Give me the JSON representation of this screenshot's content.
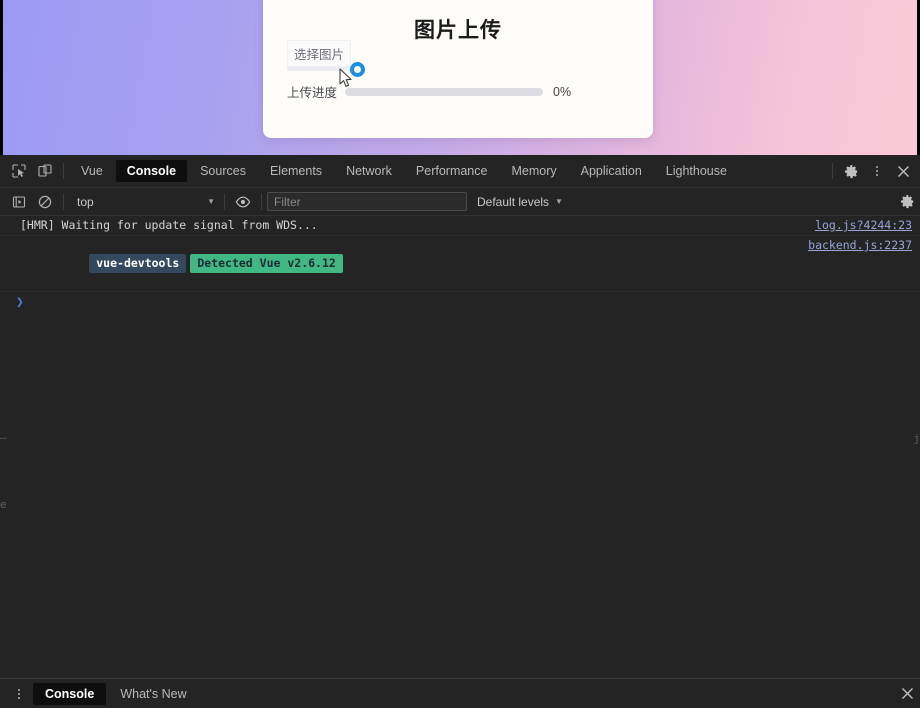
{
  "page": {
    "title": "图片上传",
    "file_button_label": "选择图片",
    "progress_label": "上传进度",
    "progress_value_text": "0%",
    "progress_percent": 0,
    "spinner_color": "#1e8fe0",
    "background_gradient_from": "#9b9bf5",
    "background_gradient_to": "#fbc9d6",
    "card_background": "#fdfcf9"
  },
  "devtools": {
    "toolbar_icons": [
      {
        "name": "inspect-element-icon",
        "title": "Inspect"
      },
      {
        "name": "device-toolbar-icon",
        "title": "Toggle device toolbar"
      }
    ],
    "tabs": [
      {
        "label": "Vue",
        "active": false
      },
      {
        "label": "Console",
        "active": true
      },
      {
        "label": "Sources",
        "active": false
      },
      {
        "label": "Elements",
        "active": false
      },
      {
        "label": "Network",
        "active": false
      },
      {
        "label": "Performance",
        "active": false
      },
      {
        "label": "Memory",
        "active": false
      },
      {
        "label": "Application",
        "active": false
      },
      {
        "label": "Lighthouse",
        "active": false
      }
    ],
    "tabbar_right_icons": [
      {
        "name": "settings-gear-icon"
      },
      {
        "name": "more-options-kebab-icon"
      },
      {
        "name": "close-devtools-icon"
      }
    ],
    "filterbar": {
      "execute_icon": "execute-sidebar-icon",
      "clear_icon": "clear-console-icon",
      "context": "top",
      "eye_icon": "live-expression-eye-icon",
      "filter_placeholder": "Filter",
      "filter_value": "",
      "levels": "Default levels",
      "settings_icon": "console-settings-gear-icon"
    },
    "messages": [
      {
        "type": "plain",
        "text": "[HMR] Waiting for update signal from WDS...",
        "source": "log.js?4244:23"
      },
      {
        "type": "badges",
        "badge_name": "vue-devtools",
        "badge_message": "Detected Vue v2.6.12",
        "source": "backend.js:2237",
        "badge_name_bg": "#35495e",
        "badge_message_bg": "#41b883"
      }
    ],
    "prompt_caret": "❯",
    "prompt_value": "",
    "drawer": {
      "kebab_icon": "drawer-more-options-icon",
      "tabs": [
        {
          "label": "Console",
          "active": true
        },
        {
          "label": "What's New",
          "active": false
        }
      ],
      "close_icon": "close-drawer-icon"
    }
  },
  "artifacts": {
    "left_fragment_top": "—",
    "left_fragment_bottom": "e",
    "right_fragment": "j"
  }
}
